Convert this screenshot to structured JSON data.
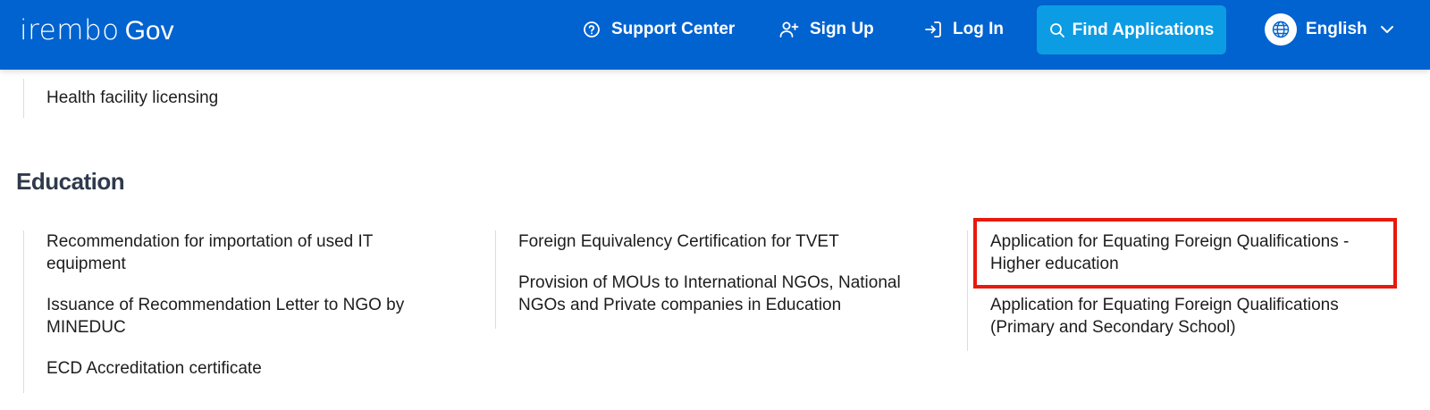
{
  "header": {
    "logo_irembo": "irembo",
    "logo_gov": "Gov",
    "support_label": "Support Center",
    "signup_label": "Sign Up",
    "login_label": "Log In",
    "find_label": "Find Applications",
    "language": "English"
  },
  "previous_section": {
    "items": [
      "Health facility licensing"
    ]
  },
  "education": {
    "title": "Education",
    "columns": [
      {
        "items": [
          "Recommendation for importation of used IT equipment",
          "Issuance of Recommendation Letter to NGO by MINEDUC",
          "ECD Accreditation certificate"
        ]
      },
      {
        "items": [
          "Foreign Equivalency Certification for TVET",
          "Provision of MOUs to International NGOs, National NGOs and Private companies in Education"
        ]
      },
      {
        "items": [
          "Application for Equating Foreign Qualifications - Higher education",
          "Application for Equating Foreign Qualifications (Primary and Secondary School)"
        ]
      }
    ]
  },
  "colors": {
    "header_bg": "#0063cf",
    "find_button_bg": "#0c9ce3",
    "highlight": "#e8190d"
  }
}
